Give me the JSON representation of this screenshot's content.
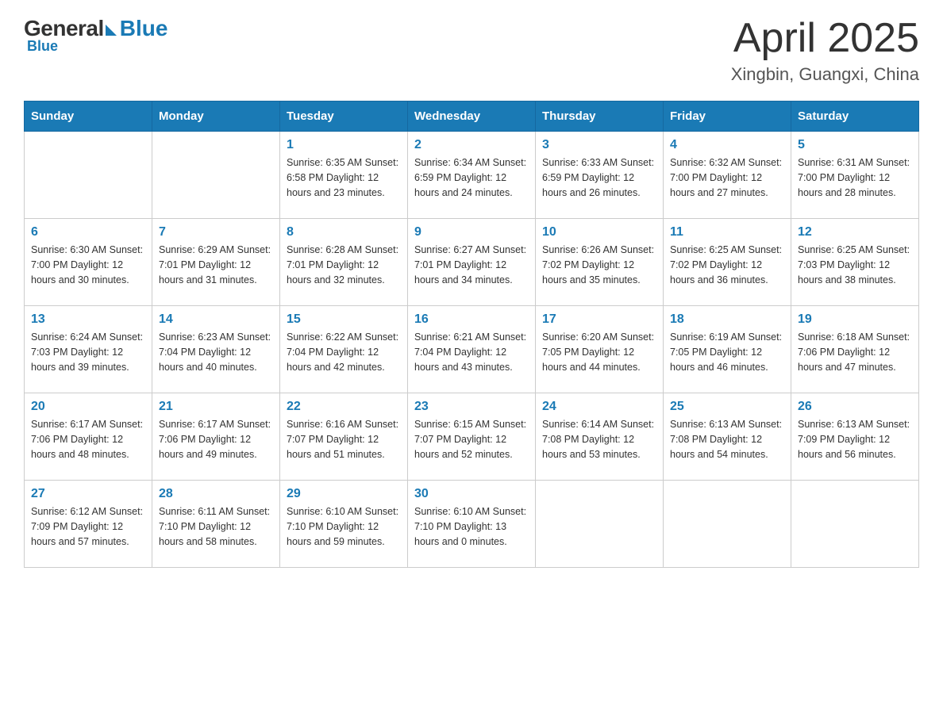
{
  "header": {
    "logo": {
      "general": "General",
      "blue": "Blue",
      "tagline": "Blue"
    },
    "title": "April 2025",
    "location": "Xingbin, Guangxi, China"
  },
  "calendar": {
    "days_of_week": [
      "Sunday",
      "Monday",
      "Tuesday",
      "Wednesday",
      "Thursday",
      "Friday",
      "Saturday"
    ],
    "weeks": [
      [
        {
          "day": "",
          "info": ""
        },
        {
          "day": "",
          "info": ""
        },
        {
          "day": "1",
          "info": "Sunrise: 6:35 AM\nSunset: 6:58 PM\nDaylight: 12 hours\nand 23 minutes."
        },
        {
          "day": "2",
          "info": "Sunrise: 6:34 AM\nSunset: 6:59 PM\nDaylight: 12 hours\nand 24 minutes."
        },
        {
          "day": "3",
          "info": "Sunrise: 6:33 AM\nSunset: 6:59 PM\nDaylight: 12 hours\nand 26 minutes."
        },
        {
          "day": "4",
          "info": "Sunrise: 6:32 AM\nSunset: 7:00 PM\nDaylight: 12 hours\nand 27 minutes."
        },
        {
          "day": "5",
          "info": "Sunrise: 6:31 AM\nSunset: 7:00 PM\nDaylight: 12 hours\nand 28 minutes."
        }
      ],
      [
        {
          "day": "6",
          "info": "Sunrise: 6:30 AM\nSunset: 7:00 PM\nDaylight: 12 hours\nand 30 minutes."
        },
        {
          "day": "7",
          "info": "Sunrise: 6:29 AM\nSunset: 7:01 PM\nDaylight: 12 hours\nand 31 minutes."
        },
        {
          "day": "8",
          "info": "Sunrise: 6:28 AM\nSunset: 7:01 PM\nDaylight: 12 hours\nand 32 minutes."
        },
        {
          "day": "9",
          "info": "Sunrise: 6:27 AM\nSunset: 7:01 PM\nDaylight: 12 hours\nand 34 minutes."
        },
        {
          "day": "10",
          "info": "Sunrise: 6:26 AM\nSunset: 7:02 PM\nDaylight: 12 hours\nand 35 minutes."
        },
        {
          "day": "11",
          "info": "Sunrise: 6:25 AM\nSunset: 7:02 PM\nDaylight: 12 hours\nand 36 minutes."
        },
        {
          "day": "12",
          "info": "Sunrise: 6:25 AM\nSunset: 7:03 PM\nDaylight: 12 hours\nand 38 minutes."
        }
      ],
      [
        {
          "day": "13",
          "info": "Sunrise: 6:24 AM\nSunset: 7:03 PM\nDaylight: 12 hours\nand 39 minutes."
        },
        {
          "day": "14",
          "info": "Sunrise: 6:23 AM\nSunset: 7:04 PM\nDaylight: 12 hours\nand 40 minutes."
        },
        {
          "day": "15",
          "info": "Sunrise: 6:22 AM\nSunset: 7:04 PM\nDaylight: 12 hours\nand 42 minutes."
        },
        {
          "day": "16",
          "info": "Sunrise: 6:21 AM\nSunset: 7:04 PM\nDaylight: 12 hours\nand 43 minutes."
        },
        {
          "day": "17",
          "info": "Sunrise: 6:20 AM\nSunset: 7:05 PM\nDaylight: 12 hours\nand 44 minutes."
        },
        {
          "day": "18",
          "info": "Sunrise: 6:19 AM\nSunset: 7:05 PM\nDaylight: 12 hours\nand 46 minutes."
        },
        {
          "day": "19",
          "info": "Sunrise: 6:18 AM\nSunset: 7:06 PM\nDaylight: 12 hours\nand 47 minutes."
        }
      ],
      [
        {
          "day": "20",
          "info": "Sunrise: 6:17 AM\nSunset: 7:06 PM\nDaylight: 12 hours\nand 48 minutes."
        },
        {
          "day": "21",
          "info": "Sunrise: 6:17 AM\nSunset: 7:06 PM\nDaylight: 12 hours\nand 49 minutes."
        },
        {
          "day": "22",
          "info": "Sunrise: 6:16 AM\nSunset: 7:07 PM\nDaylight: 12 hours\nand 51 minutes."
        },
        {
          "day": "23",
          "info": "Sunrise: 6:15 AM\nSunset: 7:07 PM\nDaylight: 12 hours\nand 52 minutes."
        },
        {
          "day": "24",
          "info": "Sunrise: 6:14 AM\nSunset: 7:08 PM\nDaylight: 12 hours\nand 53 minutes."
        },
        {
          "day": "25",
          "info": "Sunrise: 6:13 AM\nSunset: 7:08 PM\nDaylight: 12 hours\nand 54 minutes."
        },
        {
          "day": "26",
          "info": "Sunrise: 6:13 AM\nSunset: 7:09 PM\nDaylight: 12 hours\nand 56 minutes."
        }
      ],
      [
        {
          "day": "27",
          "info": "Sunrise: 6:12 AM\nSunset: 7:09 PM\nDaylight: 12 hours\nand 57 minutes."
        },
        {
          "day": "28",
          "info": "Sunrise: 6:11 AM\nSunset: 7:10 PM\nDaylight: 12 hours\nand 58 minutes."
        },
        {
          "day": "29",
          "info": "Sunrise: 6:10 AM\nSunset: 7:10 PM\nDaylight: 12 hours\nand 59 minutes."
        },
        {
          "day": "30",
          "info": "Sunrise: 6:10 AM\nSunset: 7:10 PM\nDaylight: 13 hours\nand 0 minutes."
        },
        {
          "day": "",
          "info": ""
        },
        {
          "day": "",
          "info": ""
        },
        {
          "day": "",
          "info": ""
        }
      ]
    ]
  }
}
